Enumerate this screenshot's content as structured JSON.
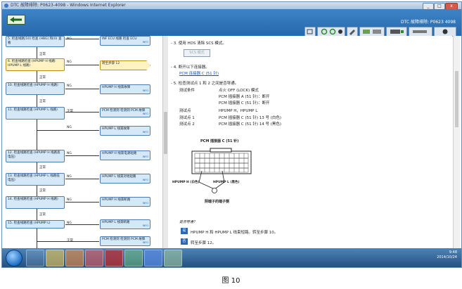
{
  "window": {
    "title": "DTC 故障排除: P0623-4098 - Windows Internet Explorer",
    "minimize": "_",
    "maximize": "□",
    "close": "x"
  },
  "header": {
    "title": "DTC 故障排除: P0623 4098"
  },
  "flow": {
    "nodes": [
      "5. 检查线路[10] 检查 (HBG) 和(0) 查看",
      "6. 检查线路检查 (HPUMP H 线路: HPUMP L 线路)",
      "10. 检查线路检查 (HPUMP H 线路)",
      "11. 检查线路检查 (HPUMP L 线路)",
      "12. 检查线路检查 (HPUMP H 线路高电压)",
      "13. 检查线路检查 (HPUMP L 线路低电压)",
      "14. 检查线路检查 (HPUMP H 线路)",
      "15. 检查线路检查 (HPUMP L)"
    ],
    "normal": "正常",
    "ng": "NG",
    "results": [
      {
        "text": "INF ECU 线路 检查 ECU",
        "info": "INFO"
      },
      {
        "text": "转至步骤 12",
        "info": ""
      },
      {
        "text": "HPUMP H 线束故障",
        "info": "INFO"
      },
      {
        "text": "PCM 检测到 检测到 PCM 故障",
        "info": "INFO"
      },
      {
        "text": "HPUMP L 线束故障",
        "info": "INFO"
      },
      {
        "text": "HPUMP H 线束电源短路",
        "info": "INFO"
      },
      {
        "text": "HPUMP L 线束对地短路",
        "info": "INFO"
      },
      {
        "text": "HPUMP H 线束断路",
        "info": "INFO"
      },
      {
        "text": "HPUMP L 线束断路",
        "info": "INFO"
      },
      {
        "text": "PCM 检测到 检测到 PCM 故障",
        "info": "INFO"
      }
    ]
  },
  "detail": {
    "step3": "- 3. 使用 HDS 清除 SCS 模式。",
    "step3_button": "SCS 模式",
    "step4": "- 4. 断开以下连接器。",
    "step4_link": "PCM 连接器 C (51 针)",
    "step5": "- 5. 检查测试点 1 和 2 之间是否导通。",
    "cond_label": "测试条件",
    "cond_lines": [
      "点火 OFF (LOCK) 模式",
      "PCM 插接器 A (51 针)：断开",
      "PCM 插接器 C (51 针)：断开"
    ],
    "probe_label": "测试点",
    "probe_value": "HPUMP H，HPUMP L",
    "tp1_label": "测试点 1",
    "tp1_value": "PCM 插接器 C (51 针) 13 号 (白色)",
    "tp2_label": "测试点 2",
    "tp2_value": "PCM 插接器 C (51 针) 14 号 (黑色)",
    "connector_title": "PCM 插接器 C (51 针)",
    "pin_h": "HPUMP H (白色)",
    "pin_l": "HPUMP L (黑色)",
    "connector_caption": "阴端子的端子侧",
    "question": "是否导通？",
    "answer_yes_tag": "是",
    "answer_yes": "HPUMP H 和 HPUMP L 线束短路。转至步骤 10。",
    "answer_no_tag": "否",
    "answer_no": "转至步骤 12。"
  },
  "taskbar": {
    "time": "9:48",
    "date": "2014/10/24"
  },
  "caption": "图 10",
  "colors": {
    "header": "#2f74b8",
    "node": "#d4e8f8",
    "highlight": "#fff3c4"
  }
}
